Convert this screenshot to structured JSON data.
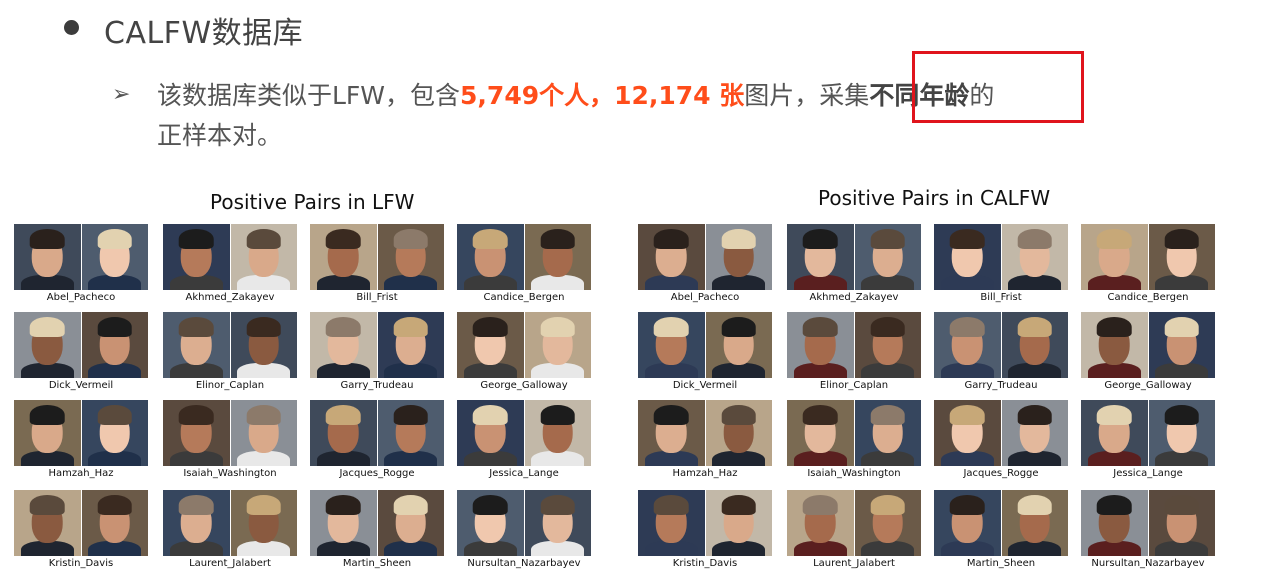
{
  "heading": "CALFW数据库",
  "description": {
    "part1": "该数据库类似于LFW，包含",
    "persons": "5,749个人，",
    "images": "12,174 张",
    "part2": "图片，采集",
    "emphasis": "不同年龄",
    "part3": "的",
    "line2": "正样本对。"
  },
  "panels": [
    {
      "title": "Positive Pairs in LFW",
      "names": [
        "Abel_Pacheco",
        "Akhmed_Zakayev",
        "Bill_Frist",
        "Candice_Bergen",
        "Dick_Vermeil",
        "Elinor_Caplan",
        "Garry_Trudeau",
        "George_Galloway",
        "Hamzah_Haz",
        "Isaiah_Washington",
        "Jacques_Rogge",
        "Jessica_Lange",
        "Kristin_Davis",
        "Laurent_Jalabert",
        "Martin_Sheen",
        "Nursultan_Nazarbayev"
      ]
    },
    {
      "title": "Positive Pairs in CALFW",
      "names": [
        "Abel_Pacheco",
        "Akhmed_Zakayev",
        "Bill_Frist",
        "Candice_Bergen",
        "Dick_Vermeil",
        "Elinor_Caplan",
        "Garry_Trudeau",
        "George_Galloway",
        "Hamzah_Haz",
        "Isaiah_Washington",
        "Jacques_Rogge",
        "Jessica_Lange",
        "Kristin_Davis",
        "Laurent_Jalabert",
        "Martin_Sheen",
        "Nursultan_Nazarbayev"
      ]
    }
  ],
  "colors": {
    "highlight": "#ff4d1a",
    "box": "#e0141c"
  }
}
